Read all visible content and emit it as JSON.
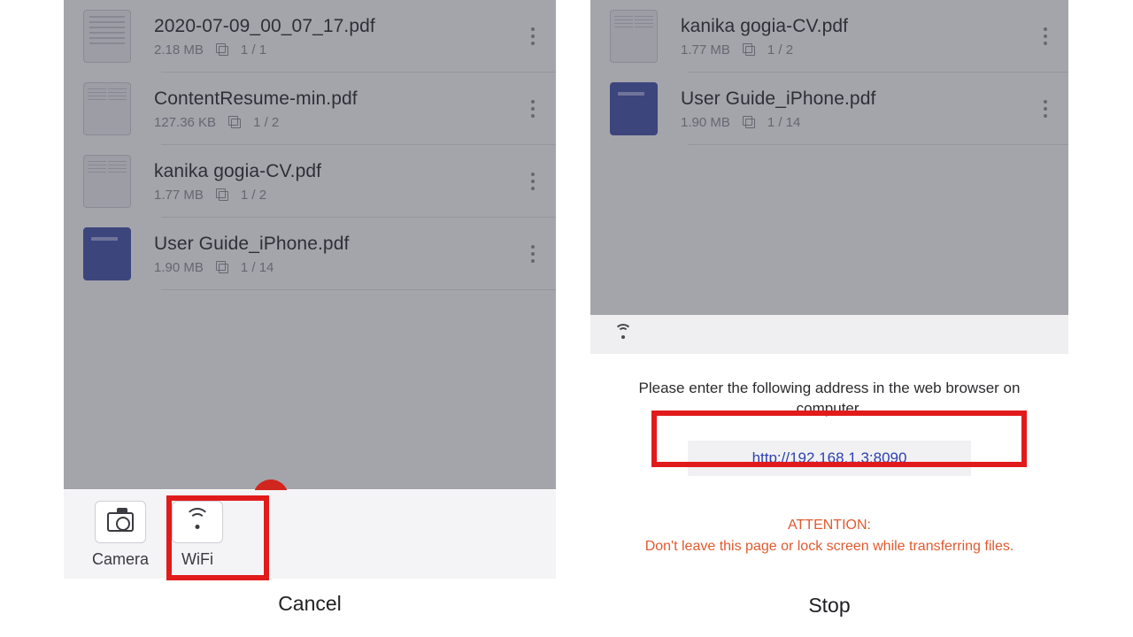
{
  "left": {
    "files": [
      {
        "name": "2020-07-09_00_07_17.pdf",
        "size": "2.18 MB",
        "pages": "1 / 1",
        "thumb": "doc"
      },
      {
        "name": "ContentResume-min.pdf",
        "size": "127.36 KB",
        "pages": "1 / 2",
        "thumb": "twocol"
      },
      {
        "name": "kanika gogia-CV.pdf",
        "size": "1.77 MB",
        "pages": "1 / 2",
        "thumb": "twocol"
      },
      {
        "name": "User Guide_iPhone.pdf",
        "size": "1.90 MB",
        "pages": "1 / 14",
        "thumb": "blue"
      }
    ],
    "tools": {
      "camera": "Camera",
      "wifi": "WiFi"
    },
    "cancel": "Cancel"
  },
  "right": {
    "files": [
      {
        "name": "kanika gogia-CV.pdf",
        "size": "1.77 MB",
        "pages": "1 / 2",
        "thumb": "twocol"
      },
      {
        "name": "User Guide_iPhone.pdf",
        "size": "1.90 MB",
        "pages": "1 / 14",
        "thumb": "blue"
      }
    ],
    "instruction": "Please enter the following address in the web browser on computer.",
    "url": "http://192.168.1.3:8090",
    "attention_title": "ATTENTION:",
    "attention_body": "Don't leave this page or lock screen while transferring files.",
    "stop": "Stop"
  }
}
